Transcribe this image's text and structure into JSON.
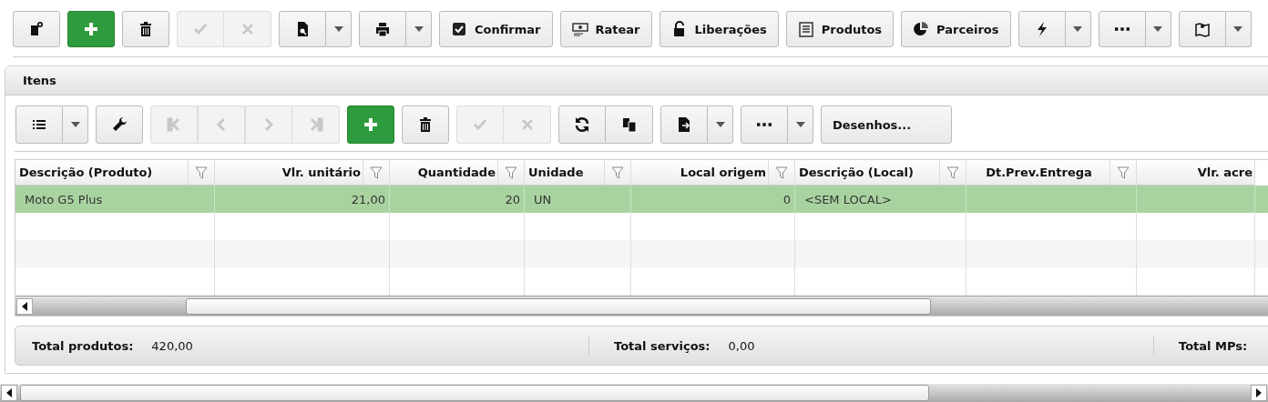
{
  "toolbar": {
    "edit_actions_disabled": true,
    "labeled_buttons": [
      {
        "label": "Confirmar"
      },
      {
        "label": "Ratear"
      },
      {
        "label": "Liberações"
      },
      {
        "label": "Produtos"
      },
      {
        "label": "Parceiros"
      }
    ]
  },
  "panel": {
    "title": "Itens",
    "toolbar": {
      "navigation_disabled": true,
      "edit_actions_disabled": true,
      "drawings_button": "Desenhos..."
    },
    "table": {
      "columns": [
        {
          "label": "Descrição (Produto)"
        },
        {
          "label": "Vlr. unitário"
        },
        {
          "label": "Quantidade"
        },
        {
          "label": "Unidade"
        },
        {
          "label": "Local origem"
        },
        {
          "label": "Descrição (Local)"
        },
        {
          "label": "Dt.Prev.Entrega"
        },
        {
          "label": "Vlr. acre"
        }
      ],
      "rows": [
        {
          "cells": [
            "Moto G5 Plus",
            "21,00",
            "20",
            "UN",
            "0",
            "<SEM LOCAL>"
          ],
          "selected": true
        }
      ]
    },
    "totals": [
      {
        "label": "Total produtos:",
        "value": "420,00"
      },
      {
        "label": "Total serviços:",
        "value": "0,00"
      },
      {
        "label": "Total MPs:"
      }
    ]
  }
}
